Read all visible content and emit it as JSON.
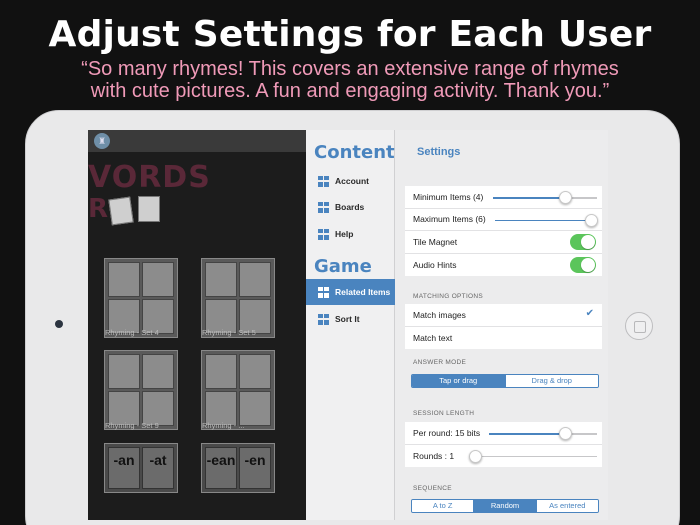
{
  "banner": {
    "headline": "Adjust Settings for Each User",
    "quote_line1": "“So many rhymes! This covers an extensive range of rhymes",
    "quote_line2": "with cute pictures. A fun and engaging activity. Thank you.”"
  },
  "game": {
    "title": "VORDS",
    "subtitle": "R",
    "tiles": [
      {
        "label": "Rhyming - Set 4"
      },
      {
        "label": "Rhyming - Set 5"
      },
      {
        "label": "Rhyming - Set 9"
      },
      {
        "label": "Rhyming - ..."
      }
    ],
    "phonics": [
      [
        "-an",
        "-at"
      ],
      [
        "-ean",
        "-en"
      ]
    ]
  },
  "menu": {
    "contents_heading": "Contents",
    "contents_items": [
      {
        "label": "Account",
        "icon": "grid-icon"
      },
      {
        "label": "Boards",
        "icon": "grid-icon"
      },
      {
        "label": "Help",
        "icon": "grid-icon"
      }
    ],
    "game_heading": "Game",
    "game_items": [
      {
        "label": "Related Items",
        "icon": "grid-icon",
        "active": true
      },
      {
        "label": "Sort It",
        "icon": "grid-icon",
        "active": false
      }
    ]
  },
  "settings": {
    "title": "Settings",
    "min_items_label": "Minimum Items (4)",
    "min_items_value": 4,
    "max_items_label": "Maximum Items (6)",
    "max_items_value": 6,
    "tile_magnet_label": "Tile Magnet",
    "tile_magnet_on": true,
    "audio_hints_label": "Audio Hints",
    "audio_hints_on": true,
    "matching_options_label": "MATCHING OPTIONS",
    "match_images_label": "Match images",
    "match_images_checked": true,
    "match_text_label": "Match text",
    "answer_mode_label": "ANSWER MODE",
    "answer_modes": [
      "Tap or drag",
      "Drag & drop"
    ],
    "answer_mode_selected": "Tap or drag",
    "session_length_label": "SESSION LENGTH",
    "per_round_label": "Per round: 15 bits",
    "per_round_value": 15,
    "rounds_label": "Rounds : 1",
    "rounds_value": 1,
    "sequence_label": "SEQUENCE",
    "sequence_options": [
      "A to Z",
      "Random",
      "As entered"
    ],
    "sequence_selected": "Random"
  },
  "colors": {
    "accent": "#4a84bf",
    "toggle_on": "#5bc55b",
    "quote": "#f09ab8"
  }
}
